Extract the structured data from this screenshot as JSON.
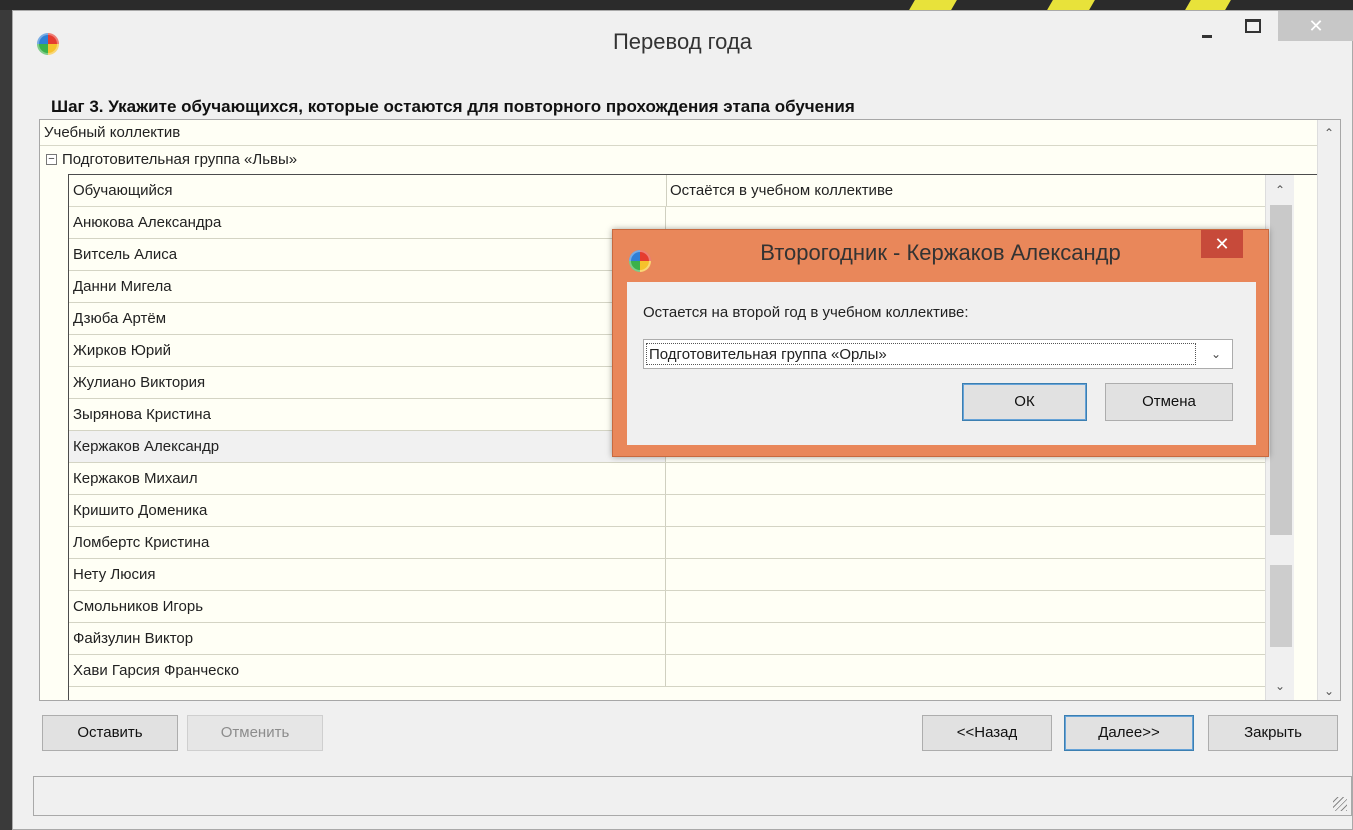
{
  "window": {
    "title": "Перевод года",
    "controls": {
      "minimize": "–",
      "maximize": "☐",
      "close": "✕"
    }
  },
  "step_heading": "Шаг 3. Укажите обучающихся, которые остаются для повторного прохождения этапа обучения",
  "outer_grid": {
    "column_header": "Учебный коллектив",
    "group": {
      "expander": "−",
      "label": "Подготовительная группа «Львы»"
    }
  },
  "inner_grid": {
    "columns": [
      "Обучающийся",
      "Остаётся в учебном коллективе"
    ],
    "rows": [
      {
        "student": "Анюкова Александра",
        "remains": ""
      },
      {
        "student": "Витсель Алиса",
        "remains": ""
      },
      {
        "student": "Данни Мигела",
        "remains": ""
      },
      {
        "student": "Дзюба Артём",
        "remains": ""
      },
      {
        "student": "Жирков Юрий",
        "remains": ""
      },
      {
        "student": "Жулиано Виктория",
        "remains": ""
      },
      {
        "student": "Зырянова Кристина",
        "remains": ""
      },
      {
        "student": "Кержаков Александр",
        "remains": "",
        "selected": true
      },
      {
        "student": "Кержаков Михаил",
        "remains": ""
      },
      {
        "student": "Кришито Доменика",
        "remains": ""
      },
      {
        "student": "Ломбертс Кристина",
        "remains": ""
      },
      {
        "student": "Нету Люсия",
        "remains": ""
      },
      {
        "student": "Смольников Игорь",
        "remains": ""
      },
      {
        "student": "Файзулин Виктор",
        "remains": ""
      },
      {
        "student": "Хави Гарсия Франческо",
        "remains": ""
      }
    ]
  },
  "buttons": {
    "leave": "Оставить",
    "cancel": "Отменить",
    "back": "<<Назад",
    "next": "Далее>>",
    "close": "Закрыть"
  },
  "dialog": {
    "title": "Второгодник - Кержаков Александр",
    "close": "✕",
    "label": "Остается на второй год в учебном коллективе:",
    "select_value": "Подготовительная группа «Орлы»",
    "ok": "ОК",
    "cancel": "Отмена"
  },
  "glyphs": {
    "up": "⌃",
    "down": "⌄",
    "dropdown": "⌄"
  },
  "colors": {
    "dialog_frame": "#e9875a",
    "dialog_close": "#c74a3a",
    "grid_bg": "#fffff5"
  }
}
